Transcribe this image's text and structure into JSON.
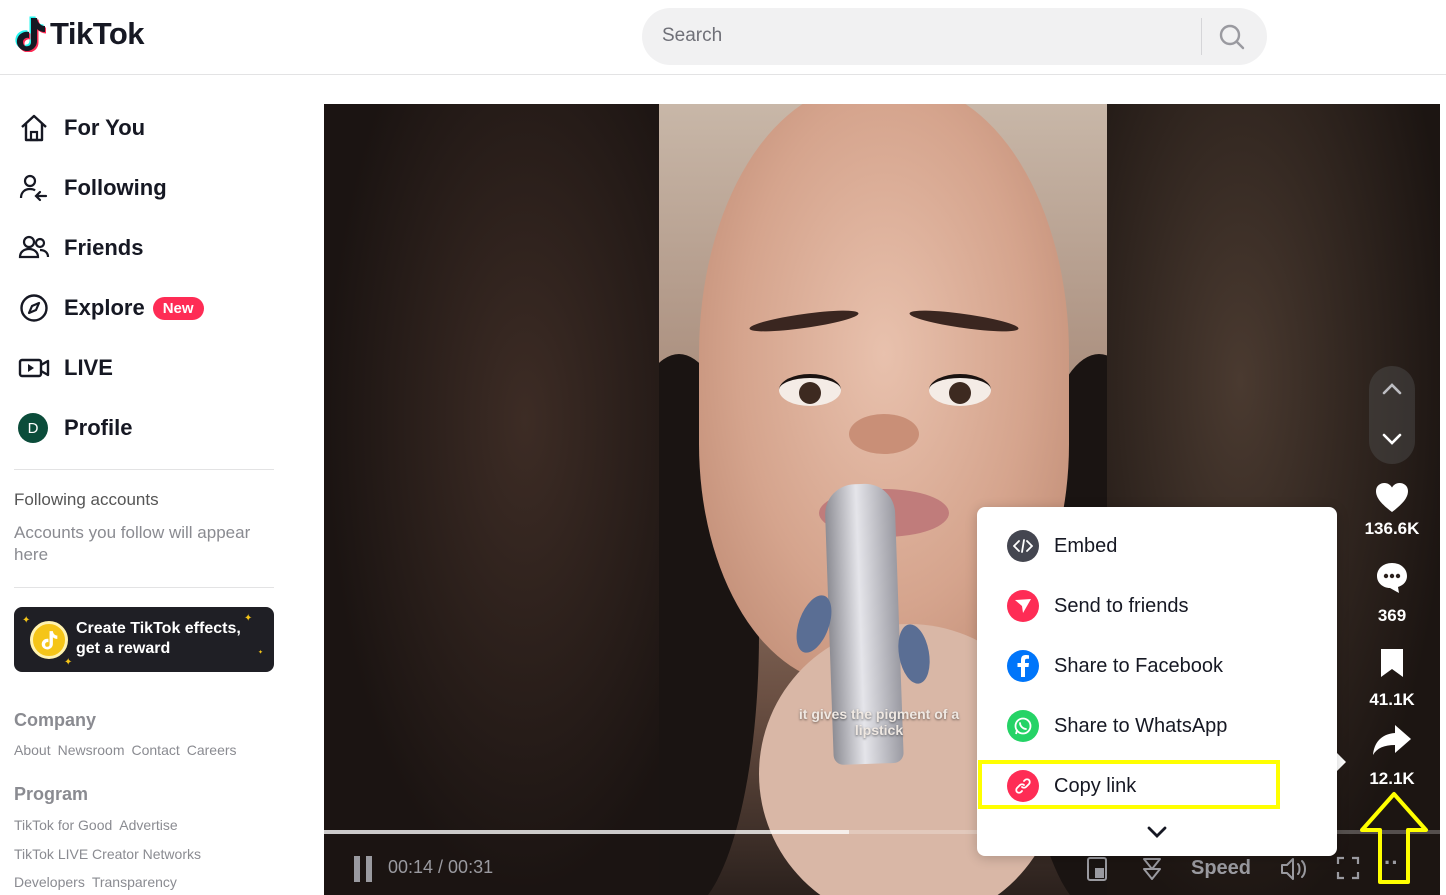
{
  "header": {
    "logo_text": "TikTok",
    "search_placeholder": "Search"
  },
  "sidebar": {
    "nav": [
      {
        "label": "For You",
        "icon": "home-icon"
      },
      {
        "label": "Following",
        "icon": "following-icon"
      },
      {
        "label": "Friends",
        "icon": "friends-icon"
      },
      {
        "label": "Explore",
        "icon": "compass-icon",
        "badge": "New"
      },
      {
        "label": "LIVE",
        "icon": "live-icon"
      },
      {
        "label": "Profile",
        "icon": "avatar",
        "avatar_letter": "D"
      }
    ],
    "following_accounts_title": "Following accounts",
    "following_accounts_desc": "Accounts you follow will appear here",
    "effects_banner_text": "Create TikTok effects, get a reward",
    "footer": {
      "company_title": "Company",
      "company_links": [
        "About",
        "Newsroom",
        "Contact",
        "Careers"
      ],
      "program_title": "Program",
      "program_links_1": [
        "TikTok for Good",
        "Advertise"
      ],
      "program_links_2": [
        "TikTok LIVE Creator Networks"
      ],
      "program_links_3": [
        "Developers",
        "Transparency"
      ]
    }
  },
  "video": {
    "caption": "it gives the pigment of a lipstick",
    "time": "00:14 / 00:31",
    "progress_fraction": 0.47,
    "speed_label": "Speed"
  },
  "actions": {
    "likes": "136.6K",
    "comments": "369",
    "saves": "41.1K",
    "shares": "12.1K"
  },
  "share_menu": {
    "items": [
      {
        "label": "Embed",
        "icon": "embed-icon",
        "color": "#444650"
      },
      {
        "label": "Send to friends",
        "icon": "send-icon",
        "color": "#fe2c55"
      },
      {
        "label": "Share to Facebook",
        "icon": "facebook-icon",
        "color": "#0075fa"
      },
      {
        "label": "Share to WhatsApp",
        "icon": "whatsapp-icon",
        "color": "#25d366"
      },
      {
        "label": "Copy link",
        "icon": "link-icon",
        "color": "#fe2c55"
      }
    ]
  },
  "colors": {
    "accent": "#fe2c55",
    "highlight": "#ffff00"
  }
}
